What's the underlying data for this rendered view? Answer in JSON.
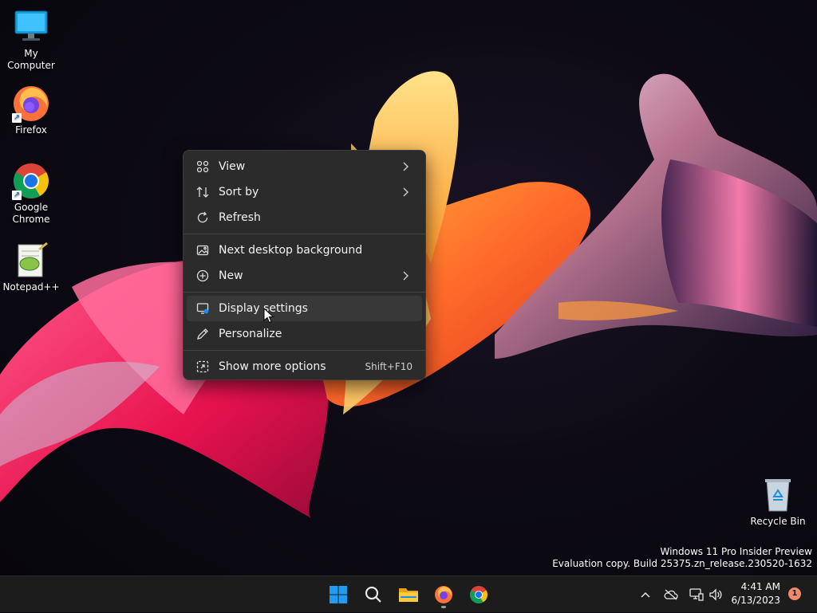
{
  "desktop": {
    "icons": [
      {
        "label": "My Computer",
        "icon": "monitor-icon"
      },
      {
        "label": "Firefox",
        "icon": "firefox-icon"
      },
      {
        "label": "Google Chrome",
        "icon": "chrome-icon"
      },
      {
        "label": "Notepad++",
        "icon": "notepadpp-icon"
      }
    ],
    "recycle_bin": {
      "label": "Recycle Bin",
      "icon": "recycle-bin-icon"
    }
  },
  "context_menu": {
    "items": [
      {
        "label": "View",
        "icon": "view-grid-icon",
        "has_submenu": true
      },
      {
        "label": "Sort by",
        "icon": "sort-icon",
        "has_submenu": true
      },
      {
        "label": "Refresh",
        "icon": "refresh-icon",
        "has_submenu": false
      },
      {
        "label": "Next desktop background",
        "icon": "background-icon",
        "has_submenu": false
      },
      {
        "label": "New",
        "icon": "new-icon",
        "has_submenu": true
      },
      {
        "label": "Display settings",
        "icon": "display-icon",
        "has_submenu": false
      },
      {
        "label": "Personalize",
        "icon": "pen-icon",
        "has_submenu": false
      },
      {
        "label": "Show more options",
        "icon": "more-options-icon",
        "has_submenu": false,
        "shortcut": "Shift+F10"
      }
    ],
    "hovered": "Display settings"
  },
  "watermark": {
    "line1": "Windows 11 Pro Insider Preview",
    "line2": "Evaluation copy. Build 25375.zn_release.230520-1632"
  },
  "taskbar": {
    "pinned": [
      "start-icon",
      "search-icon",
      "file-explorer-icon",
      "firefox-icon",
      "chrome-icon"
    ],
    "tray": {
      "icons": [
        "chevron-up-icon",
        "onedrive-offline-icon",
        "network-icon",
        "volume-icon"
      ],
      "time": "4:41 AM",
      "date": "6/13/2023",
      "notification_count": "1"
    }
  },
  "colors": {
    "menu_bg": "#2b2b2b",
    "menu_hover": "#383838",
    "taskbar_bg": "#1c1c1c",
    "accent": "#1a8cff",
    "notification_badge": "#f08a6c"
  }
}
